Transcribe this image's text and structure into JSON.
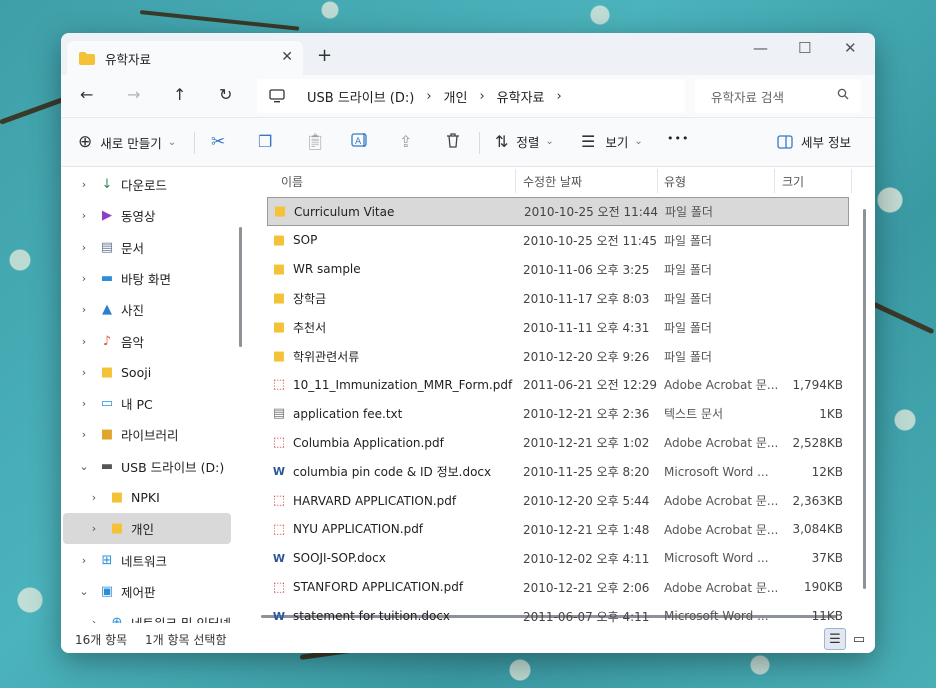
{
  "colors": {
    "accent": "#3778c8",
    "folder": "#f3c237",
    "pdf": "#d83b3b",
    "word": "#2b579a"
  },
  "tab": {
    "title": "유학자료",
    "icon": "folder-icon",
    "close": "✕",
    "new_tab": "+"
  },
  "window_controls": {
    "minimize": "—",
    "maximize": "☐",
    "close": "✕"
  },
  "nav": {
    "back": "←",
    "forward": "→",
    "up": "↑",
    "refresh": "↻"
  },
  "breadcrumb": {
    "items": [
      "USB 드라이브 (D:)",
      "개인",
      "유학자료"
    ],
    "sep": "›"
  },
  "search": {
    "placeholder": "유학자료 검색"
  },
  "toolbar": {
    "new_label": "새로 만들기",
    "sort_label": "정렬",
    "view_label": "보기",
    "more": "•••",
    "details_label": "세부 정보"
  },
  "sidebar": {
    "items": [
      {
        "label": "다운로드",
        "icon": "download-icon",
        "chevron": "›"
      },
      {
        "label": "동영상",
        "icon": "video-icon",
        "chevron": "›"
      },
      {
        "label": "문서",
        "icon": "document-icon",
        "chevron": "›"
      },
      {
        "label": "바탕 화면",
        "icon": "desktop-icon",
        "chevron": "›"
      },
      {
        "label": "사진",
        "icon": "pictures-icon",
        "chevron": "›"
      },
      {
        "label": "음악",
        "icon": "music-icon",
        "chevron": "›"
      },
      {
        "label": "Sooji",
        "icon": "folder-icon",
        "chevron": "›"
      },
      {
        "label": "내 PC",
        "icon": "pc-icon",
        "chevron": "›"
      },
      {
        "label": "라이브러리",
        "icon": "library-icon",
        "chevron": "›"
      },
      {
        "label": "USB 드라이브 (D:)",
        "icon": "usb-drive-icon",
        "chevron": "⌄"
      },
      {
        "label": "NPKI",
        "icon": "folder-icon",
        "chevron": "›"
      },
      {
        "label": "개인",
        "icon": "folder-icon",
        "chevron": "›"
      },
      {
        "label": "네트워크",
        "icon": "network-icon",
        "chevron": "›"
      },
      {
        "label": "제어판",
        "icon": "control-panel-icon",
        "chevron": "⌄"
      },
      {
        "label": "네트워크 및 인터넷",
        "icon": "network-internet-icon",
        "chevron": "›"
      }
    ]
  },
  "columns": {
    "name": "이름",
    "date": "수정한 날짜",
    "type": "유형",
    "size": "크기",
    "sort": "^"
  },
  "files": [
    {
      "name": "Curriculum Vitae",
      "date": "2010-10-25 오전 11:44",
      "type": "파일 폴더",
      "size": "",
      "icon": "folder"
    },
    {
      "name": "SOP",
      "date": "2010-10-25 오전 11:45",
      "type": "파일 폴더",
      "size": "",
      "icon": "folder"
    },
    {
      "name": "WR sample",
      "date": "2010-11-06 오후 3:25",
      "type": "파일 폴더",
      "size": "",
      "icon": "folder"
    },
    {
      "name": "장학금",
      "date": "2010-11-17 오후 8:03",
      "type": "파일 폴더",
      "size": "",
      "icon": "folder"
    },
    {
      "name": "추천서",
      "date": "2010-11-11 오후 4:31",
      "type": "파일 폴더",
      "size": "",
      "icon": "folder"
    },
    {
      "name": "학위관련서류",
      "date": "2010-12-20 오후 9:26",
      "type": "파일 폴더",
      "size": "",
      "icon": "folder"
    },
    {
      "name": "10_11_Immunization_MMR_Form.pdf",
      "date": "2011-06-21 오전 12:29",
      "type": "Adobe Acrobat 문...",
      "size": "1,794KB",
      "icon": "pdf"
    },
    {
      "name": "application fee.txt",
      "date": "2010-12-21 오후 2:36",
      "type": "텍스트 문서",
      "size": "1KB",
      "icon": "txt"
    },
    {
      "name": "Columbia Application.pdf",
      "date": "2010-12-21 오후 1:02",
      "type": "Adobe Acrobat 문...",
      "size": "2,528KB",
      "icon": "pdf"
    },
    {
      "name": "columbia pin code & ID 정보.docx",
      "date": "2010-11-25 오후 8:20",
      "type": "Microsoft Word ...",
      "size": "12KB",
      "icon": "word"
    },
    {
      "name": "HARVARD APPLICATION.pdf",
      "date": "2010-12-20 오후 5:44",
      "type": "Adobe Acrobat 문...",
      "size": "2,363KB",
      "icon": "pdf"
    },
    {
      "name": "NYU APPLICATION.pdf",
      "date": "2010-12-21 오후 1:48",
      "type": "Adobe Acrobat 문...",
      "size": "3,084KB",
      "icon": "pdf"
    },
    {
      "name": "SOOJI-SOP.docx",
      "date": "2010-12-02 오후 4:11",
      "type": "Microsoft Word ...",
      "size": "37KB",
      "icon": "word"
    },
    {
      "name": "STANFORD APPLICATION.pdf",
      "date": "2010-12-21 오후 2:06",
      "type": "Adobe Acrobat 문...",
      "size": "190KB",
      "icon": "pdf"
    },
    {
      "name": "statement for tuition.docx",
      "date": "2011-06-07 오후 4:11",
      "type": "Microsoft Word ...",
      "size": "11KB",
      "icon": "word"
    }
  ],
  "status": {
    "count": "16개 항목",
    "selected": "1개 항목 선택함"
  }
}
